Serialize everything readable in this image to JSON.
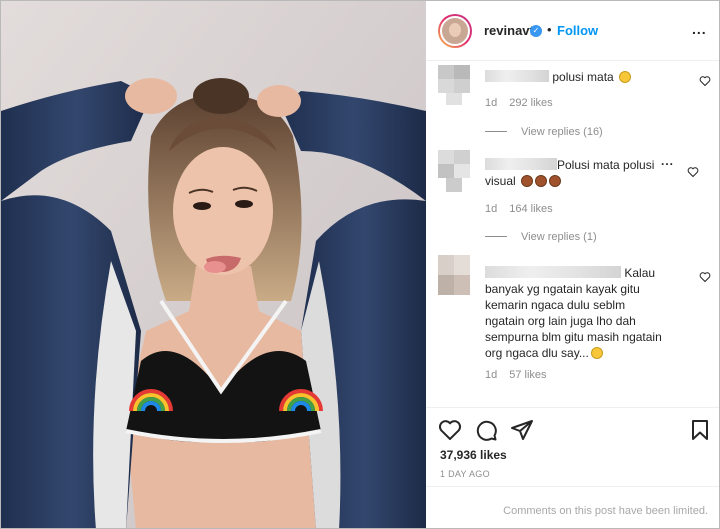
{
  "post": {
    "username": "revinavt",
    "follow_label": "Follow",
    "dot": "•",
    "more": "...",
    "verified_glyph": "✓"
  },
  "comments": [
    {
      "text": "polusi mata",
      "emoji": "neutral-face-emoji",
      "time": "1d",
      "likes": "292 likes",
      "replies": "View replies (16)"
    },
    {
      "text": "Polusi mata polusi",
      "text2": "visual",
      "emoji": "see-no-evil-monkey-emoji",
      "time": "1d",
      "likes": "164 likes",
      "replies": "View replies (1)"
    },
    {
      "text": "Kalau",
      "lines": [
        "banyak yg ngatain kayak gitu",
        "kemarin ngaca dulu seblm",
        "ngatain org lain juga lho dah",
        "sempurna blm gitu masih ngatain",
        "org ngaca dlu say..."
      ],
      "emoji": "laughing-emoji",
      "time": "1d",
      "likes": "57 likes"
    }
  ],
  "footer": {
    "likes": "37,936 likes",
    "date": "1 DAY AGO",
    "limited": "Comments on this post have been limited."
  },
  "colors": {
    "accent": "#0095f6",
    "muted": "#8e8e8e",
    "jacket": "#2b3b5c",
    "skin": "#e8b9a1"
  }
}
